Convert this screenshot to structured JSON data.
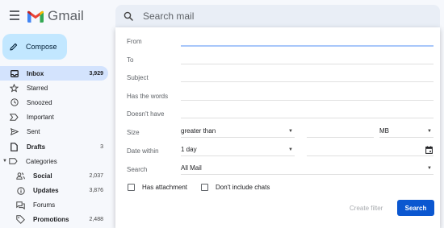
{
  "app": {
    "name": "Gmail",
    "brand_colors": [
      "#4285f4",
      "#ea4335",
      "#fbbc04",
      "#34a853",
      "#c5221f"
    ]
  },
  "search": {
    "placeholder": "Search mail"
  },
  "compose": {
    "label": "Compose"
  },
  "sidebar": {
    "items": [
      {
        "label": "Inbox",
        "count": "3,929",
        "icon": "inbox-icon"
      },
      {
        "label": "Starred",
        "count": "",
        "icon": "star-icon"
      },
      {
        "label": "Snoozed",
        "count": "",
        "icon": "clock-icon"
      },
      {
        "label": "Important",
        "count": "",
        "icon": "important-icon"
      },
      {
        "label": "Sent",
        "count": "",
        "icon": "send-icon"
      },
      {
        "label": "Drafts",
        "count": "3",
        "icon": "draft-icon"
      },
      {
        "label": "Categories",
        "count": "",
        "icon": "label-icon"
      },
      {
        "label": "Social",
        "count": "2,037",
        "icon": "people-icon"
      },
      {
        "label": "Updates",
        "count": "3,876",
        "icon": "info-icon"
      },
      {
        "label": "Forums",
        "count": "",
        "icon": "forum-icon"
      },
      {
        "label": "Promotions",
        "count": "2,488",
        "icon": "tag-icon"
      }
    ]
  },
  "filter": {
    "from_label": "From",
    "to_label": "To",
    "subject_label": "Subject",
    "has_words_label": "Has the words",
    "doesnt_have_label": "Doesn't have",
    "size_label": "Size",
    "size_operator": "greater than",
    "size_unit": "MB",
    "date_within_label": "Date within",
    "date_within_value": "1 day",
    "search_scope_label": "Search",
    "search_scope_value": "All Mail",
    "has_attachment_label": "Has attachment",
    "no_chats_label": "Don't include chats",
    "create_filter_label": "Create filter",
    "search_button_label": "Search"
  }
}
